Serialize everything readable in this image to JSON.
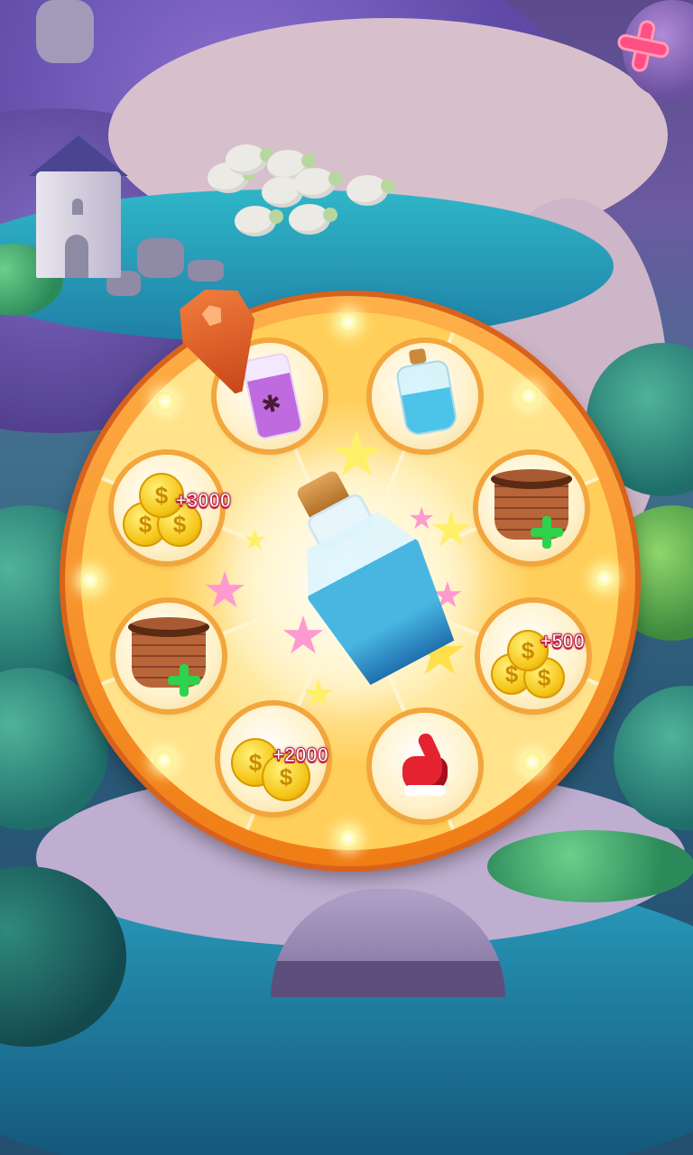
{
  "game": {
    "close_icon": "close-icon",
    "wheel": {
      "center_prize": "potion-bottle",
      "segments": [
        {
          "item": "poison-potion-jar",
          "label": ""
        },
        {
          "item": "water-bottle",
          "label": ""
        },
        {
          "item": "basket-plus",
          "label": ""
        },
        {
          "item": "gold-coins",
          "label": "+500"
        },
        {
          "item": "red-glove-hand",
          "label": ""
        },
        {
          "item": "gold-coins",
          "label": "+2000"
        },
        {
          "item": "basket-plus",
          "label": ""
        },
        {
          "item": "gold-coins",
          "label": "+3000"
        }
      ]
    },
    "colors": {
      "wheel_rim": "#f07c14",
      "wheel_light_segment": "#ffe28a",
      "wheel_dark_segment": "#ffcf5a",
      "coin_label": "#c02040",
      "close_button": "#ff4f84"
    }
  }
}
